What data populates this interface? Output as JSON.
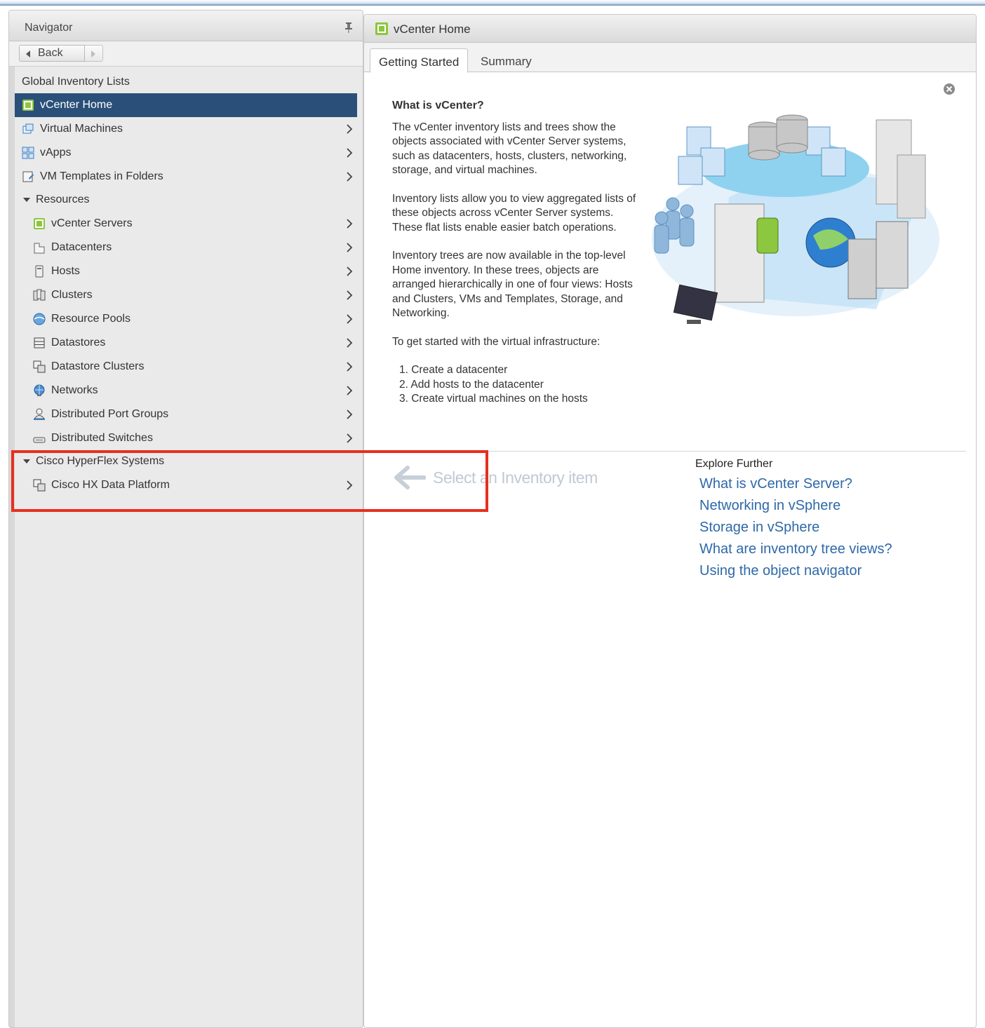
{
  "navigator": {
    "title": "Navigator",
    "back_label": "Back",
    "section_title": "Global Inventory Lists",
    "top_items": [
      {
        "label": "vCenter Home",
        "icon": "vcenter-home-icon",
        "selected": true
      },
      {
        "label": "Virtual Machines",
        "icon": "virtual-machine-icon"
      },
      {
        "label": "vApps",
        "icon": "vapp-icon"
      },
      {
        "label": "VM Templates in Folders",
        "icon": "vm-template-icon"
      }
    ],
    "resources_label": "Resources",
    "resources": [
      {
        "label": "vCenter Servers",
        "icon": "vcenter-server-icon"
      },
      {
        "label": "Datacenters",
        "icon": "datacenter-icon"
      },
      {
        "label": "Hosts",
        "icon": "host-icon"
      },
      {
        "label": "Clusters",
        "icon": "cluster-icon"
      },
      {
        "label": "Resource Pools",
        "icon": "resource-pool-icon"
      },
      {
        "label": "Datastores",
        "icon": "datastore-icon"
      },
      {
        "label": "Datastore Clusters",
        "icon": "datastore-cluster-icon"
      },
      {
        "label": "Networks",
        "icon": "network-icon"
      },
      {
        "label": "Distributed Port Groups",
        "icon": "port-group-icon"
      },
      {
        "label": "Distributed Switches",
        "icon": "distributed-switch-icon"
      }
    ],
    "hyperflex_label": "Cisco HyperFlex Systems",
    "hyperflex_items": [
      {
        "label": "Cisco HX Data Platform",
        "icon": "hx-data-platform-icon"
      }
    ]
  },
  "main": {
    "title": "vCenter Home",
    "tabs": [
      {
        "label": "Getting Started",
        "active": true
      },
      {
        "label": "Summary",
        "active": false
      }
    ],
    "heading": "What is vCenter?",
    "paragraphs": [
      "The vCenter inventory lists and trees show the objects associated with vCenter Server systems, such as datacenters, hosts, clusters, networking, storage, and virtual machines.",
      "Inventory lists allow you to view aggregated lists of these objects across vCenter Server systems.  These flat lists enable easier batch operations.",
      "Inventory trees are now available in the top-level Home inventory.  In these trees, objects are arranged hierarchically in one of four views: Hosts and Clusters, VMs and Templates, Storage, and Networking.",
      "To get started with the virtual infrastructure:"
    ],
    "steps": [
      "1. Create a datacenter",
      "2. Add hosts to the datacenter",
      "3. Create virtual machines on the hosts"
    ],
    "select_hint": "Select an Inventory item",
    "explore_title": "Explore Further",
    "explore_links": [
      "What is vCenter Server?",
      "Networking in vSphere",
      "Storage in vSphere",
      "What are inventory tree views?",
      "Using the object navigator"
    ]
  },
  "colors": {
    "selected_bg": "#2a5079",
    "link": "#2e69a8",
    "highlight_box": "#e5301f"
  }
}
